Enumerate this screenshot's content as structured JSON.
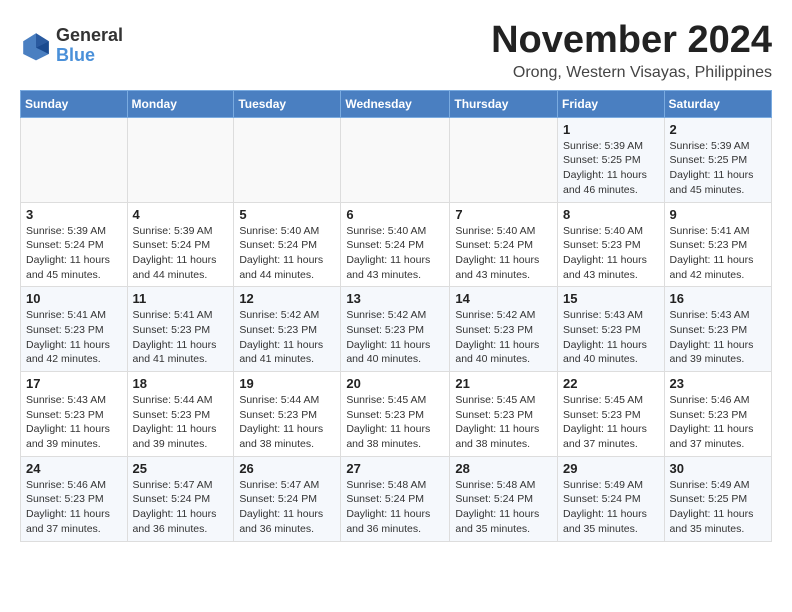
{
  "logo": {
    "line1": "General",
    "line2": "Blue"
  },
  "title": "November 2024",
  "location": "Orong, Western Visayas, Philippines",
  "weekdays": [
    "Sunday",
    "Monday",
    "Tuesday",
    "Wednesday",
    "Thursday",
    "Friday",
    "Saturday"
  ],
  "weeks": [
    [
      {
        "day": "",
        "info": ""
      },
      {
        "day": "",
        "info": ""
      },
      {
        "day": "",
        "info": ""
      },
      {
        "day": "",
        "info": ""
      },
      {
        "day": "",
        "info": ""
      },
      {
        "day": "1",
        "info": "Sunrise: 5:39 AM\nSunset: 5:25 PM\nDaylight: 11 hours and 46 minutes."
      },
      {
        "day": "2",
        "info": "Sunrise: 5:39 AM\nSunset: 5:25 PM\nDaylight: 11 hours and 45 minutes."
      }
    ],
    [
      {
        "day": "3",
        "info": "Sunrise: 5:39 AM\nSunset: 5:24 PM\nDaylight: 11 hours and 45 minutes."
      },
      {
        "day": "4",
        "info": "Sunrise: 5:39 AM\nSunset: 5:24 PM\nDaylight: 11 hours and 44 minutes."
      },
      {
        "day": "5",
        "info": "Sunrise: 5:40 AM\nSunset: 5:24 PM\nDaylight: 11 hours and 44 minutes."
      },
      {
        "day": "6",
        "info": "Sunrise: 5:40 AM\nSunset: 5:24 PM\nDaylight: 11 hours and 43 minutes."
      },
      {
        "day": "7",
        "info": "Sunrise: 5:40 AM\nSunset: 5:24 PM\nDaylight: 11 hours and 43 minutes."
      },
      {
        "day": "8",
        "info": "Sunrise: 5:40 AM\nSunset: 5:23 PM\nDaylight: 11 hours and 43 minutes."
      },
      {
        "day": "9",
        "info": "Sunrise: 5:41 AM\nSunset: 5:23 PM\nDaylight: 11 hours and 42 minutes."
      }
    ],
    [
      {
        "day": "10",
        "info": "Sunrise: 5:41 AM\nSunset: 5:23 PM\nDaylight: 11 hours and 42 minutes."
      },
      {
        "day": "11",
        "info": "Sunrise: 5:41 AM\nSunset: 5:23 PM\nDaylight: 11 hours and 41 minutes."
      },
      {
        "day": "12",
        "info": "Sunrise: 5:42 AM\nSunset: 5:23 PM\nDaylight: 11 hours and 41 minutes."
      },
      {
        "day": "13",
        "info": "Sunrise: 5:42 AM\nSunset: 5:23 PM\nDaylight: 11 hours and 40 minutes."
      },
      {
        "day": "14",
        "info": "Sunrise: 5:42 AM\nSunset: 5:23 PM\nDaylight: 11 hours and 40 minutes."
      },
      {
        "day": "15",
        "info": "Sunrise: 5:43 AM\nSunset: 5:23 PM\nDaylight: 11 hours and 40 minutes."
      },
      {
        "day": "16",
        "info": "Sunrise: 5:43 AM\nSunset: 5:23 PM\nDaylight: 11 hours and 39 minutes."
      }
    ],
    [
      {
        "day": "17",
        "info": "Sunrise: 5:43 AM\nSunset: 5:23 PM\nDaylight: 11 hours and 39 minutes."
      },
      {
        "day": "18",
        "info": "Sunrise: 5:44 AM\nSunset: 5:23 PM\nDaylight: 11 hours and 39 minutes."
      },
      {
        "day": "19",
        "info": "Sunrise: 5:44 AM\nSunset: 5:23 PM\nDaylight: 11 hours and 38 minutes."
      },
      {
        "day": "20",
        "info": "Sunrise: 5:45 AM\nSunset: 5:23 PM\nDaylight: 11 hours and 38 minutes."
      },
      {
        "day": "21",
        "info": "Sunrise: 5:45 AM\nSunset: 5:23 PM\nDaylight: 11 hours and 38 minutes."
      },
      {
        "day": "22",
        "info": "Sunrise: 5:45 AM\nSunset: 5:23 PM\nDaylight: 11 hours and 37 minutes."
      },
      {
        "day": "23",
        "info": "Sunrise: 5:46 AM\nSunset: 5:23 PM\nDaylight: 11 hours and 37 minutes."
      }
    ],
    [
      {
        "day": "24",
        "info": "Sunrise: 5:46 AM\nSunset: 5:23 PM\nDaylight: 11 hours and 37 minutes."
      },
      {
        "day": "25",
        "info": "Sunrise: 5:47 AM\nSunset: 5:24 PM\nDaylight: 11 hours and 36 minutes."
      },
      {
        "day": "26",
        "info": "Sunrise: 5:47 AM\nSunset: 5:24 PM\nDaylight: 11 hours and 36 minutes."
      },
      {
        "day": "27",
        "info": "Sunrise: 5:48 AM\nSunset: 5:24 PM\nDaylight: 11 hours and 36 minutes."
      },
      {
        "day": "28",
        "info": "Sunrise: 5:48 AM\nSunset: 5:24 PM\nDaylight: 11 hours and 35 minutes."
      },
      {
        "day": "29",
        "info": "Sunrise: 5:49 AM\nSunset: 5:24 PM\nDaylight: 11 hours and 35 minutes."
      },
      {
        "day": "30",
        "info": "Sunrise: 5:49 AM\nSunset: 5:25 PM\nDaylight: 11 hours and 35 minutes."
      }
    ]
  ]
}
